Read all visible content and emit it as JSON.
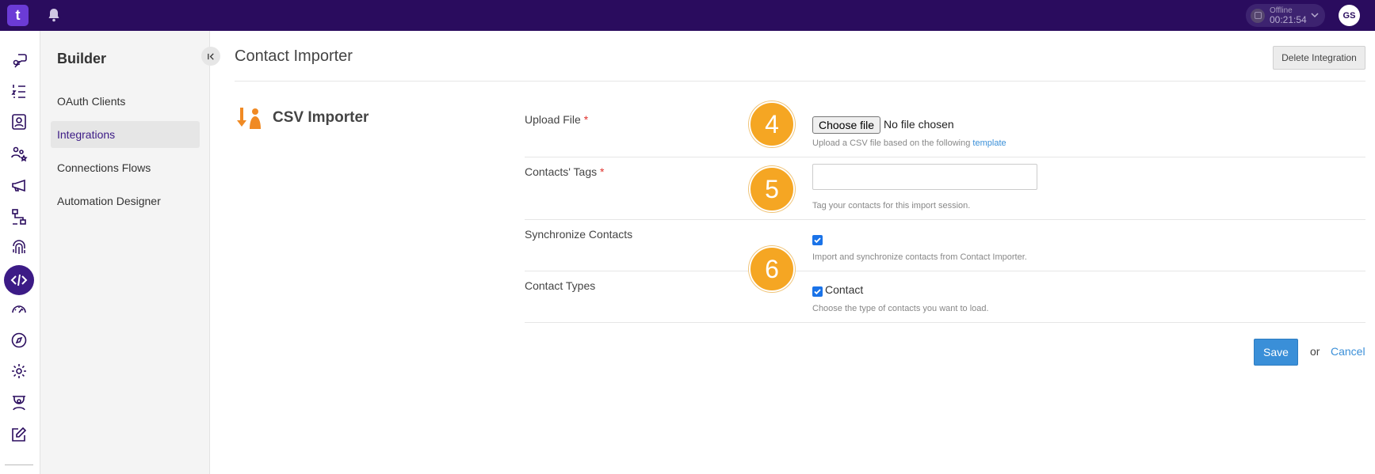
{
  "topbar": {
    "logo_text": "t",
    "status_label": "Offline",
    "status_time": "00:21:54",
    "avatar_initials": "GS"
  },
  "rail": {
    "icons": [
      "pin-chat-icon",
      "list-steps-icon",
      "contact-card-icon",
      "people-star-icon",
      "megaphone-icon",
      "flow-icon",
      "fingerprint-icon",
      "code-icon",
      "gauge-icon",
      "compass-icon",
      "gear-icon",
      "robot-person-icon",
      "edit-square-icon"
    ],
    "active": "code-icon"
  },
  "sidebar": {
    "title": "Builder",
    "items": [
      {
        "label": "OAuth Clients"
      },
      {
        "label": "Integrations"
      },
      {
        "label": "Connections Flows"
      },
      {
        "label": "Automation Designer"
      }
    ],
    "active_index": 1
  },
  "header": {
    "title": "Contact Importer",
    "delete_label": "Delete Integration"
  },
  "integration": {
    "name": "CSV Importer"
  },
  "form": {
    "upload": {
      "label": "Upload File",
      "required": "*",
      "choose_label": "Choose file",
      "file_status": "No file chosen",
      "help_prefix": "Upload a CSV file based on the following",
      "help_link": "template"
    },
    "tags": {
      "label": "Contacts' Tags",
      "required": "*",
      "value": "",
      "help": "Tag your contacts for this import session."
    },
    "sync": {
      "label": "Synchronize Contacts",
      "checked": true,
      "help": "Import and synchronize contacts from Contact Importer."
    },
    "types": {
      "label": "Contact Types",
      "option_label": "Contact",
      "checked": true,
      "help": "Choose the type of contacts you want to load."
    },
    "save_label": "Save",
    "or_text": "or",
    "cancel_label": "Cancel"
  },
  "step_badges": [
    "4",
    "5",
    "6"
  ],
  "colors": {
    "topbar": "#2a0c5e",
    "accent": "#3c1b86",
    "primary_button": "#3a8fd8",
    "badge": "#f5a623",
    "required": "#e0322d"
  }
}
